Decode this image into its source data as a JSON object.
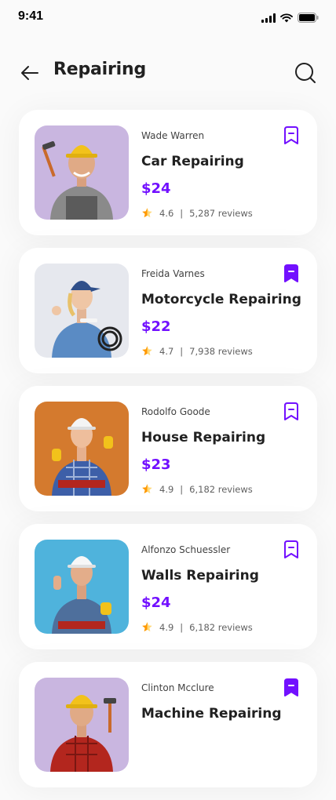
{
  "status_bar": {
    "time": "9:41"
  },
  "header": {
    "title": "Repairing"
  },
  "colors": {
    "accent": "#7210FF",
    "star": "#FFC107",
    "text": "#212121"
  },
  "services": [
    {
      "provider": "Wade Warren",
      "title": "Car Repairing",
      "price": "$24",
      "rating": "4.6",
      "separator": "|",
      "reviews": "5,287 reviews",
      "bookmarked": false,
      "photo_bg": "#c9b6e0"
    },
    {
      "provider": "Freida Varnes",
      "title": "Motorcycle Repairing",
      "price": "$22",
      "rating": "4.7",
      "separator": "|",
      "reviews": "7,938 reviews",
      "bookmarked": true,
      "photo_bg": "#e6e8ee"
    },
    {
      "provider": "Rodolfo Goode",
      "title": "House Repairing",
      "price": "$23",
      "rating": "4.9",
      "separator": "|",
      "reviews": "6,182 reviews",
      "bookmarked": false,
      "photo_bg": "#d47a2e"
    },
    {
      "provider": "Alfonzo Schuessler",
      "title": "Walls Repairing",
      "price": "$24",
      "rating": "4.9",
      "separator": "|",
      "reviews": "6,182 reviews",
      "bookmarked": false,
      "photo_bg": "#4fb3dc"
    },
    {
      "provider": "Clinton Mcclure",
      "title": "Machine Repairing",
      "price": "",
      "rating": "",
      "separator": "",
      "reviews": "",
      "bookmarked": true,
      "photo_bg": "#c9b6e0"
    }
  ]
}
